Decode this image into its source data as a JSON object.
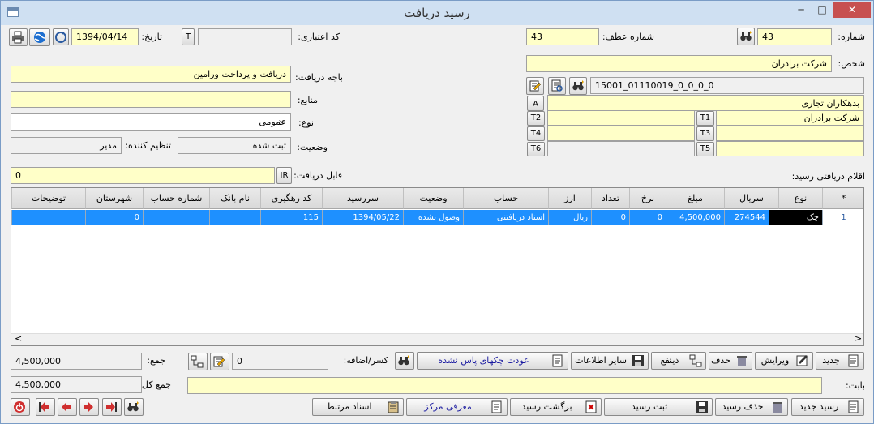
{
  "window": {
    "title": "رسید دریافت",
    "minimize": "─",
    "maximize": "□",
    "close": "✕"
  },
  "header": {
    "number_label": "شماره:",
    "number_value": "43",
    "ref_number_label": "شماره عطف:",
    "ref_number_value": "43",
    "credit_code_label": "کد اعتباری:",
    "credit_code_value": "",
    "t_label": "T",
    "date_label": "تاریخ:",
    "date_value": "1394/04/14"
  },
  "left": {
    "person_label": "شخص:",
    "person_value": "شرکت برادران",
    "account_code": "15001_01110019_0_0_0_0",
    "account_group": "بدهکاران تجاری",
    "a_label": "A",
    "t1_label": "T1",
    "t1_value": "شرکت برادران",
    "t2_label": "T2",
    "t2_value": "",
    "t3_label": "T3",
    "t3_value": "",
    "t4_label": "T4",
    "t4_value": "",
    "t5_label": "T5",
    "t5_value": "",
    "t6_label": "T6",
    "t6_value": ""
  },
  "right": {
    "box_label": "باجه دریافت:",
    "box_value": "دریافت و پرداخت ورامین",
    "source_label": "منابع:",
    "source_value": "",
    "type_label": "نوع:",
    "type_value": "عمومی",
    "status_label": "وضعیت:",
    "status_value": "ثبت شده",
    "creator_label": "تنظیم کننده:",
    "creator_value": "مدیر"
  },
  "receivable": {
    "label": "قابل دریافت:",
    "currency": "IR",
    "value": "0"
  },
  "items_label": "اقلام دریافتی رسید:",
  "table": {
    "headers": [
      "*",
      "نوع",
      "سریال",
      "مبلغ",
      "نرخ",
      "تعداد",
      "ارز",
      "حساب",
      "وضعیت",
      "سررسید",
      "کد رهگیری",
      "نام بانک",
      "شماره حساب",
      "شهرستان",
      "توضیحات"
    ],
    "rows": [
      {
        "num": "1",
        "type": "چک",
        "serial": "274544",
        "amount": "4,500,000",
        "rate": "0",
        "count": "0",
        "currency": "ریال",
        "account": "اسناد دریافتنی",
        "status": "وصول نشده",
        "due": "1394/05/22",
        "tracking": "115",
        "bank": "",
        "account_no": "",
        "city": "0",
        "desc": ""
      }
    ],
    "scroll_left": "<",
    "scroll_right": ">"
  },
  "actions": {
    "new": "جدید",
    "edit": "ویرایش",
    "delete": "حذف",
    "beneficiary": "ذینفع",
    "other_info": "سایر اطلاعات",
    "return_check": "عودت چکهای پاس نشده",
    "deduct_add_label": "کسر/اضافه:",
    "deduct_add_value": "0",
    "sum_label": "جمع:",
    "sum_value": "4,500,000"
  },
  "about": {
    "label": "بابت:",
    "value": ""
  },
  "total": {
    "label": "جمع کل:",
    "value": "4,500,000"
  },
  "footer": {
    "new_receipt": "رسید جدید",
    "delete_receipt": "حذف رسید",
    "save_receipt": "ثبت رسید",
    "return_receipt": "برگشت رسید",
    "intro_center": "معرفی مرکز",
    "related_docs": "اسناد مرتبط"
  },
  "colors": {
    "accent_blue": "#1e90ff",
    "input_yellow": "#ffffc8",
    "close_red": "#c75050",
    "link_blue": "#1a1aa0"
  }
}
